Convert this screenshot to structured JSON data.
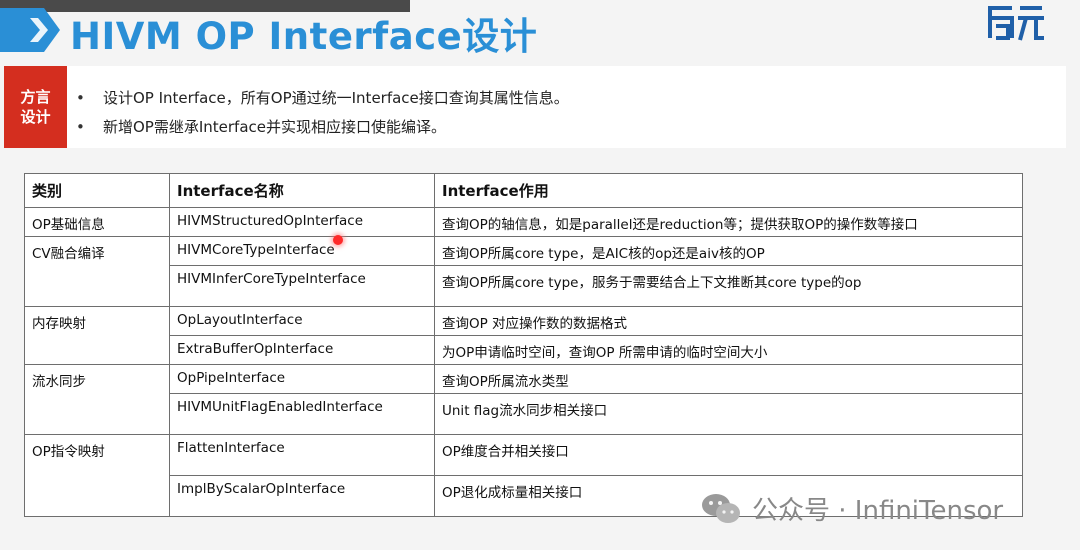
{
  "slide": {
    "title": "HIVM OP Interface设计",
    "logo_text": "启元"
  },
  "note": {
    "tag": "方言设计",
    "bullets": [
      "设计OP Interface，所有OP通过统一Interface接口查询其属性信息。",
      "新增OP需继承Interface并实现相应接口使能编译。"
    ]
  },
  "table": {
    "headers": [
      "类别",
      "Interface名称",
      "Interface作用"
    ],
    "categories": [
      "OP基础信息",
      "CV融合编译",
      "内存映射",
      "流水同步",
      "OP指令映射"
    ],
    "rows": [
      {
        "name": "HIVMStructuredOpInterface",
        "purpose": "查询OP的轴信息，如是parallel还是reduction等；提供获取OP的操作数等接口"
      },
      {
        "name": "HIVMCoreTypeInterface",
        "purpose": "查询OP所属core type，是AIC核的op还是aiv核的OP"
      },
      {
        "name": "HIVMInferCoreTypeInterface",
        "purpose": "查询OP所属core type，服务于需要结合上下文推断其core type的op"
      },
      {
        "name": "OpLayoutInterface",
        "purpose": "查询OP 对应操作数的数据格式"
      },
      {
        "name": "ExtraBufferOpInterface",
        "purpose": "为OP申请临时空间，查询OP 所需申请的临时空间大小"
      },
      {
        "name": "OpPipeInterface",
        "purpose": "查询OP所属流水类型"
      },
      {
        "name": "HIVMUnitFlagEnabledInterface",
        "purpose": "Unit flag流水同步相关接口"
      },
      {
        "name": "FlattenInterface",
        "purpose": "OP维度合并相关接口"
      },
      {
        "name": "ImplByScalarOpInterface",
        "purpose": "OP退化成标量相关接口"
      }
    ]
  },
  "watermark": {
    "text": "公众号 · InfiniTensor",
    "icon": "wechat-icon"
  },
  "colors": {
    "title": "#2a8fd6",
    "tag_bg": "#d42e1f",
    "logo": "#1f5fa8"
  }
}
